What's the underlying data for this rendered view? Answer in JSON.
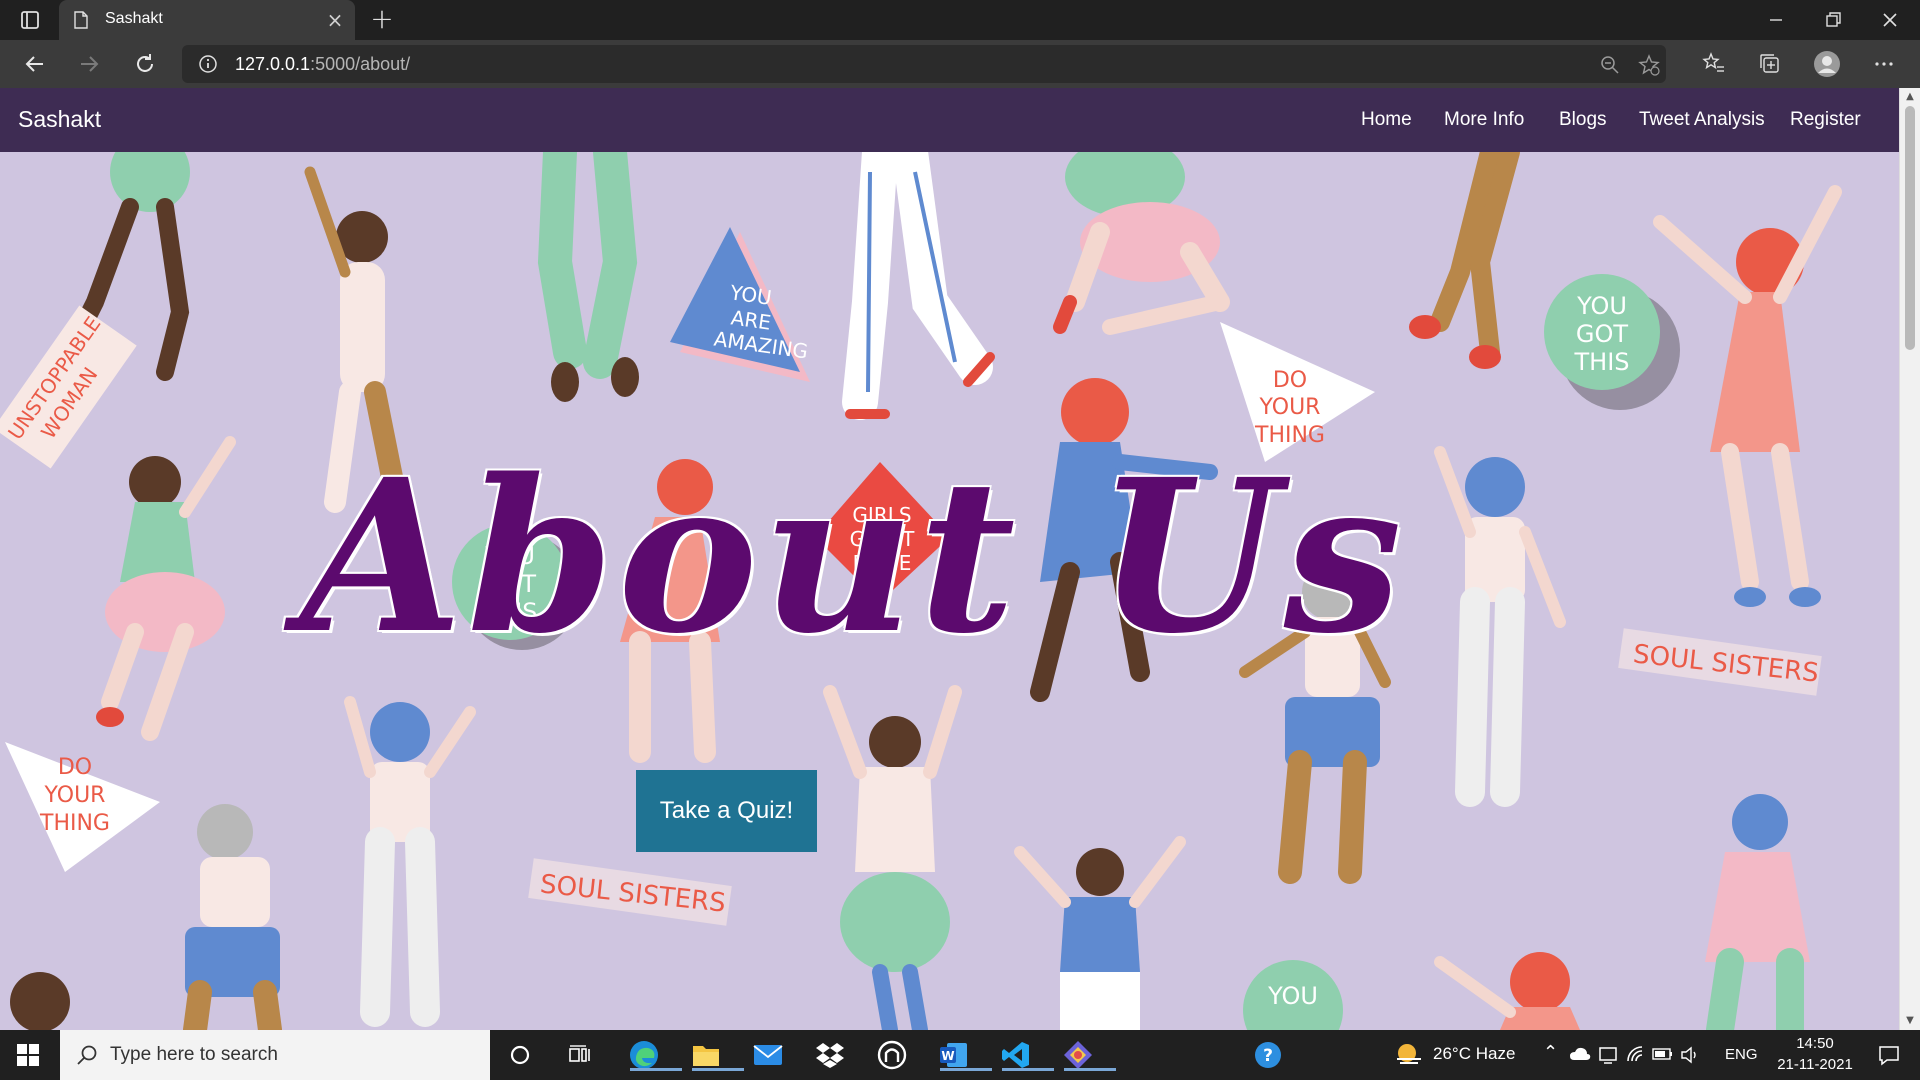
{
  "browser": {
    "tab_title": "Sashakt",
    "url_host": "127.0.0.1",
    "url_rest": ":5000/about/"
  },
  "navbar": {
    "brand": "Sashakt",
    "links": [
      "Home",
      "More Info",
      "Blogs",
      "Tweet Analysis",
      "Register"
    ]
  },
  "hero": {
    "title": "About Us",
    "quiz_button": "Take a Quiz!",
    "background_stickers": [
      "YOU ARE AMAZING",
      "UNSTOPPABLE WOMAN",
      "DO YOUR THING",
      "YOU GOT THIS",
      "GIRLS GET IT DONE",
      "SOUL SISTERS",
      "YOU"
    ]
  },
  "taskbar": {
    "search_placeholder": "Type here to search",
    "weather": "26°C  Haze",
    "language": "ENG",
    "time": "14:50",
    "date": "21-11-2021"
  },
  "colors": {
    "navbar_bg": "#3e2c53",
    "hero_bg": "#cfc5e0",
    "title_color": "#5c0a6e",
    "button_bg": "#1f7393"
  }
}
